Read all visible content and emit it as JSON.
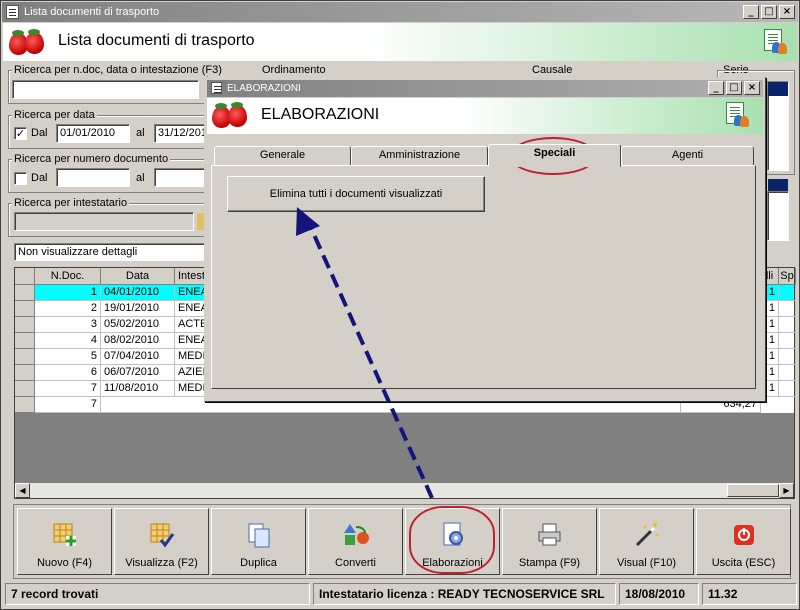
{
  "window": {
    "title": "Lista documenti di trasporto"
  },
  "header": {
    "title": "Lista documenti di trasporto"
  },
  "search": {
    "group_label": "Ricerca per n.doc, data o intestazione (F3)",
    "value": ""
  },
  "ordinamento": {
    "label": "Ordinamento"
  },
  "causale": {
    "label": "Causale"
  },
  "serie": {
    "label": "Serie"
  },
  "date_search": {
    "label": "Ricerca per data",
    "checked": "✓",
    "dal_label": "Dal",
    "dal_value": "01/01/2010",
    "al_label": "al",
    "al_value": "31/12/2010"
  },
  "number_search": {
    "label": "Ricerca per numero documento",
    "dal_label": "Dal",
    "al_label": "al"
  },
  "holder_search": {
    "label": "Ricerca per intestatario"
  },
  "details_select": {
    "value": "Non visualizzare dettagli"
  },
  "grid": {
    "columns": [
      "N.Doc.",
      "Data",
      "Intest",
      "lli",
      "Sp"
    ],
    "rows": [
      {
        "num": "1",
        "date": "04/01/2010",
        "holder": "ENEA",
        "extra": "1"
      },
      {
        "num": "2",
        "date": "19/01/2010",
        "holder": "ENEA",
        "extra": "1"
      },
      {
        "num": "3",
        "date": "05/02/2010",
        "holder": "ACTE",
        "extra": "1"
      },
      {
        "num": "4",
        "date": "08/02/2010",
        "holder": "ENEA",
        "extra": "1"
      },
      {
        "num": "5",
        "date": "07/04/2010",
        "holder": "MEDI",
        "extra": "1"
      },
      {
        "num": "6",
        "date": "06/07/2010",
        "holder": "AZIEI",
        "extra": "1"
      },
      {
        "num": "7",
        "date": "11/08/2010",
        "holder": "MEDI",
        "extra": "1"
      }
    ],
    "total_count": "7",
    "total_value": "634,27"
  },
  "toolbar": {
    "buttons": [
      {
        "label": "Nuovo (F4)"
      },
      {
        "label": "Visualizza (F2)"
      },
      {
        "label": "Duplica"
      },
      {
        "label": "Converti"
      },
      {
        "label": "Elaborazioni"
      },
      {
        "label": "Stampa (F9)"
      },
      {
        "label": "Visual (F10)"
      },
      {
        "label": "Uscita (ESC)"
      }
    ]
  },
  "status": {
    "records": "7 record trovati",
    "license": "Intestatario licenza : READY TECNOSERVICE SRL",
    "date": "18/08/2010",
    "time": "11.32"
  },
  "dialog": {
    "title": "ELABORAZIONI",
    "header": "ELABORAZIONI",
    "tabs": [
      "Generale",
      "Amministrazione",
      "Speciali",
      "Agenti"
    ],
    "active_tab": "Speciali",
    "action_button": "Elimina tutti i documenti visualizzati"
  },
  "colors": {
    "highlight_oval": "#c0202a",
    "arrow": "#1a1a8a",
    "selected_row": "#00ffff"
  }
}
